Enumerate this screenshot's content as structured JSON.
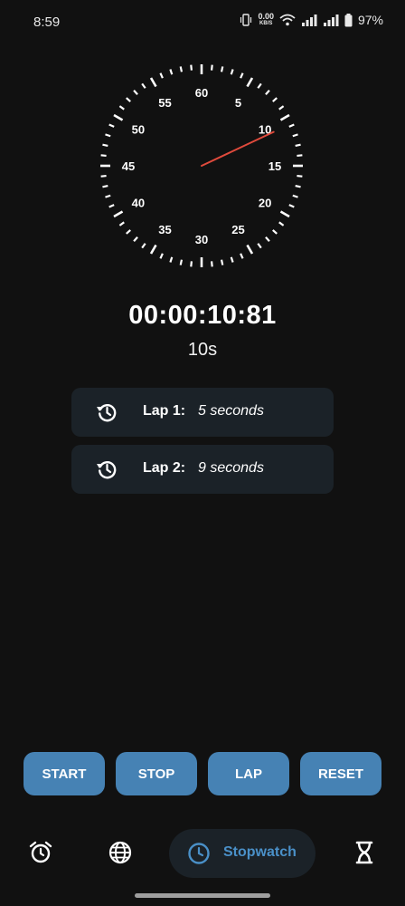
{
  "status_bar": {
    "time": "8:59",
    "net_speed_value": "0.00",
    "net_speed_unit": "KB/S",
    "battery": "97%"
  },
  "dial": {
    "numbers": [
      "60",
      "5",
      "10",
      "15",
      "20",
      "25",
      "30",
      "35",
      "40",
      "45",
      "50",
      "55"
    ],
    "hand_color": "#e04a3c",
    "hand_position_seconds": 10.81
  },
  "readout": {
    "time": "00:00:10:81",
    "seconds": "10s"
  },
  "laps": [
    {
      "label": "Lap 1:",
      "value": "5 seconds"
    },
    {
      "label": "Lap 2:",
      "value": "9 seconds"
    }
  ],
  "controls": {
    "start": "START",
    "stop": "STOP",
    "lap": "LAP",
    "reset": "RESET"
  },
  "nav": {
    "active_label": "Stopwatch",
    "items": [
      "alarm-icon",
      "globe-icon",
      "stopwatch-icon",
      "hourglass-icon"
    ]
  },
  "colors": {
    "accent": "#4682b4",
    "background": "#111111",
    "card": "#1b2228"
  }
}
